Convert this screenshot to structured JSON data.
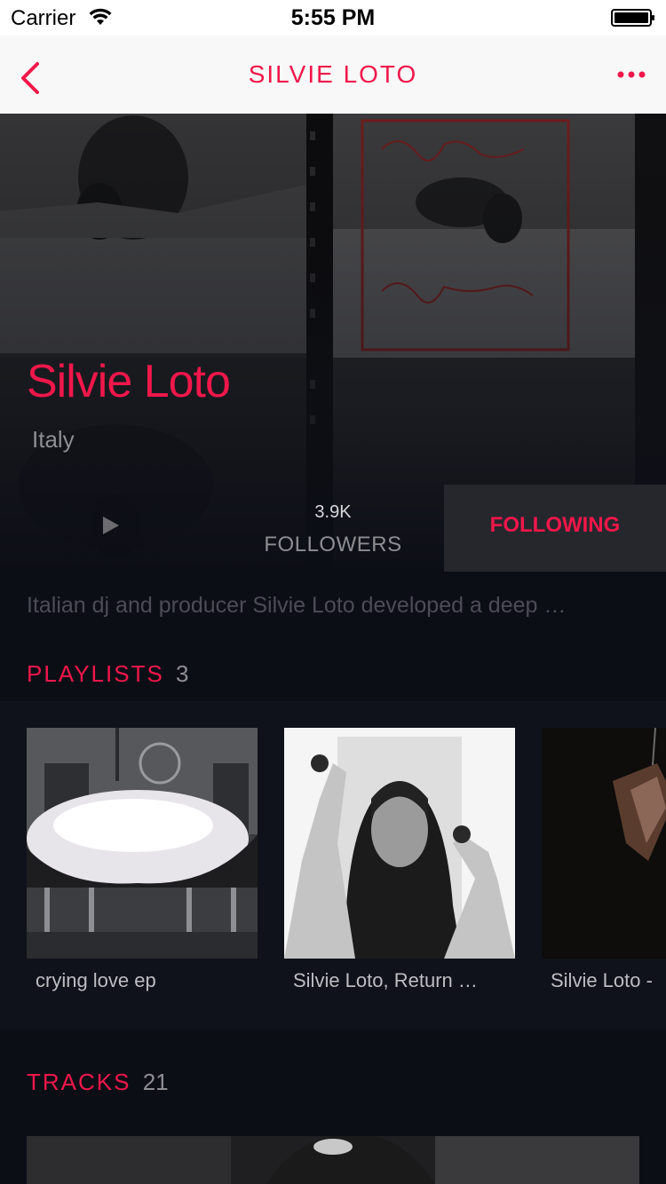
{
  "status_bar": {
    "carrier": "Carrier",
    "time": "5:55 PM"
  },
  "nav": {
    "title": "SILVIE LOTO",
    "back_icon": "chevron-left-icon",
    "more_icon": "more-dots-icon"
  },
  "artist": {
    "name": "Silvie Loto",
    "country": "Italy",
    "followers_count": "3.9K",
    "followers_label": "FOLLOWERS",
    "following_label": "FOLLOWING",
    "bio": "Italian dj and producer Silvie Loto developed a deep …"
  },
  "playlists": {
    "label": "PLAYLISTS",
    "count": "3",
    "items": [
      {
        "title": "crying love ep"
      },
      {
        "title": "Silvie Loto, Return …"
      },
      {
        "title": "Silvie Loto -"
      }
    ]
  },
  "tracks": {
    "label": "TRACKS",
    "count": "21"
  },
  "colors": {
    "accent": "#f0174a",
    "background": "#0c0e16",
    "nav_background": "#f8f8f8",
    "following_button": "#26272d"
  }
}
